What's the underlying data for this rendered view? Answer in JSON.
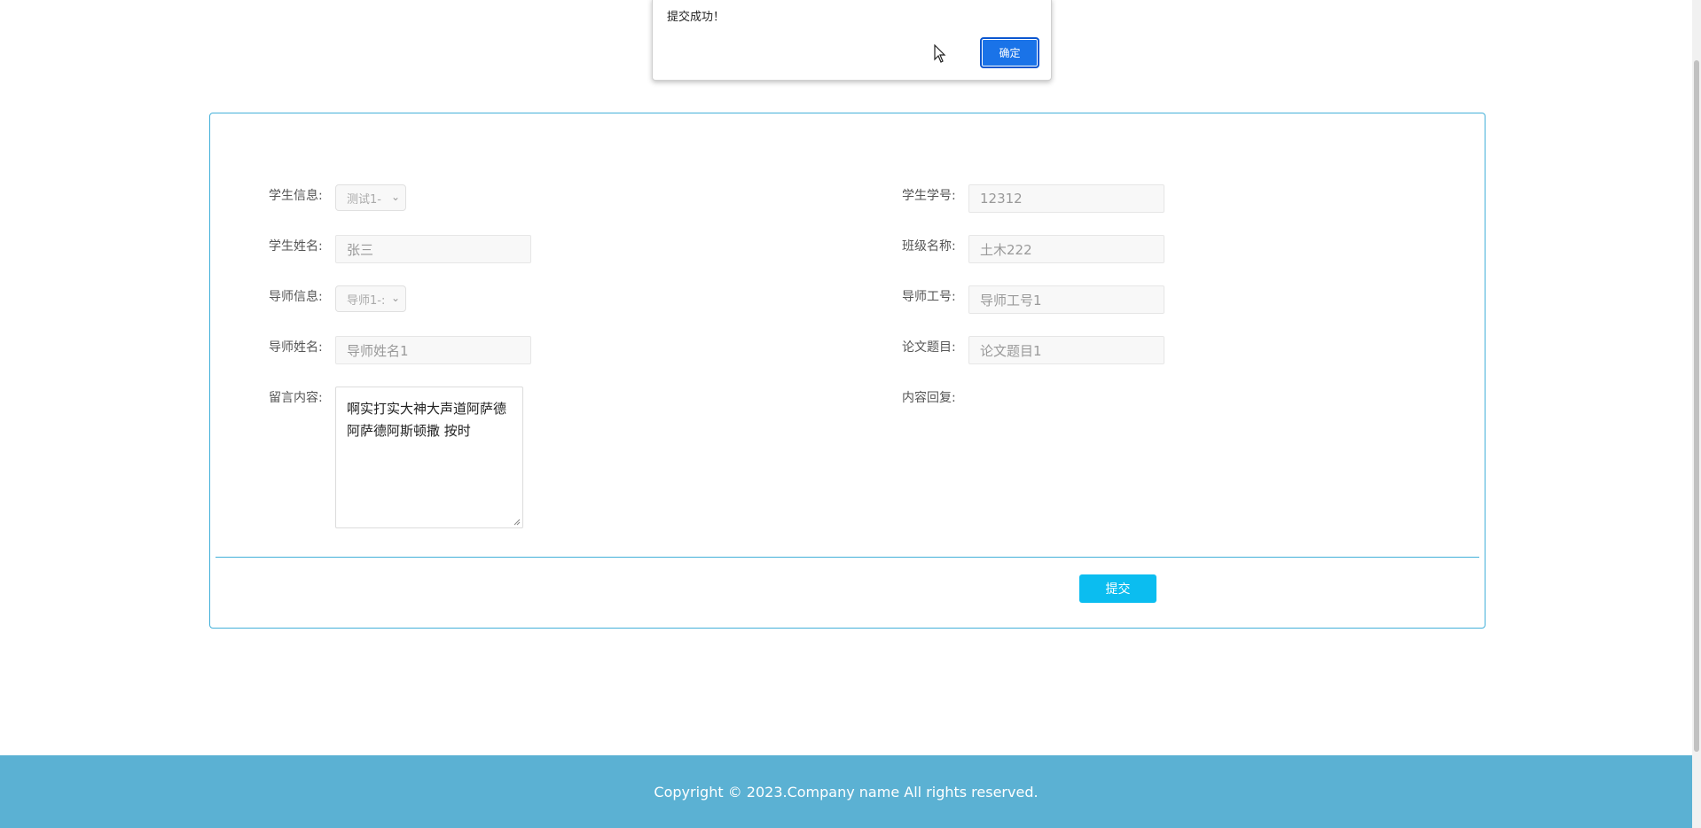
{
  "dialog": {
    "message": "提交成功！",
    "ok_label": "确定"
  },
  "form": {
    "student_info": {
      "label": "学生信息:",
      "value": "测试1-"
    },
    "student_no": {
      "label": "学生学号:",
      "value": "12312"
    },
    "student_name": {
      "label": "学生姓名:",
      "value": "张三"
    },
    "class_name": {
      "label": "班级名称:",
      "value": "土木222"
    },
    "tutor_info": {
      "label": "导师信息:",
      "value": "导师1-:"
    },
    "tutor_no": {
      "label": "导师工号:",
      "value": "导师工号1"
    },
    "tutor_name": {
      "label": "导师姓名:",
      "value": "导师姓名1"
    },
    "thesis_title": {
      "label": "论文题目:",
      "value": "论文题目1"
    },
    "message": {
      "label": "留言内容:",
      "value": "啊实打实大神大声道阿萨德阿萨德阿斯顿撒 按时"
    },
    "reply": {
      "label": "内容回复:"
    },
    "submit_label": "提交"
  },
  "footer": {
    "copyright": "Copyright © 2023.Company name All rights reserved."
  },
  "colors": {
    "panel_border": "#43b0d9",
    "submit_bg": "#0bbdf0",
    "footer_bg": "#5bb1d3",
    "dialog_ok_bg": "#1a73e8"
  }
}
